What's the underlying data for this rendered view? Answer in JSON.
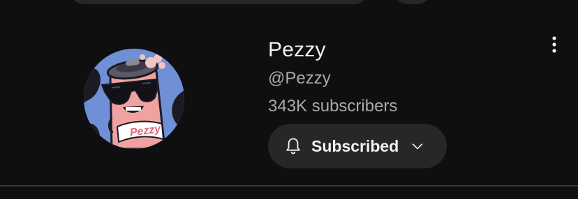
{
  "channel": {
    "name": "Pezzy",
    "handle": "@Pezzy",
    "subscribers": "343K subscribers",
    "avatar_text": "Pezzy"
  },
  "subscribe": {
    "label": "Subscribed",
    "icon": "bell-icon",
    "dropdown_icon": "chevron-down-icon"
  },
  "menu": {
    "icon": "more-vertical-icon"
  },
  "colors": {
    "background": "#0f0f0f",
    "button_bg": "#272727",
    "text_primary": "#f1f1f1",
    "text_secondary": "#aaaaaa",
    "avatar_bg": "#6f8fd6",
    "can_pink": "#f0a2a0"
  }
}
